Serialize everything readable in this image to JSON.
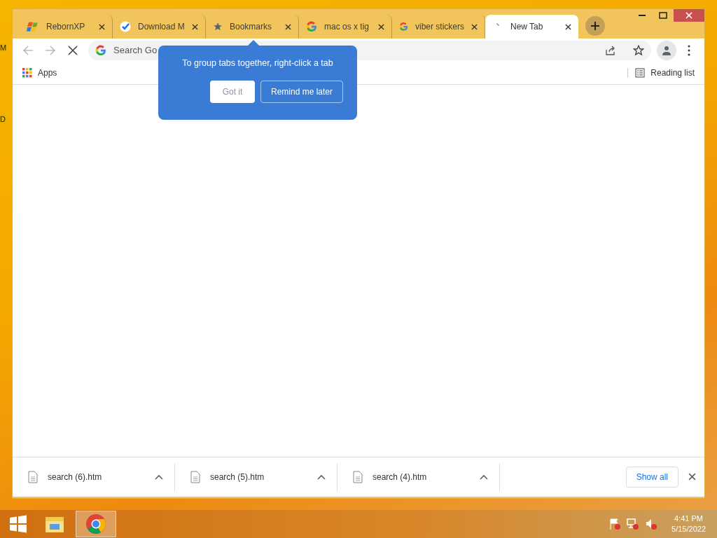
{
  "desktop_labels": [
    "M",
    "D"
  ],
  "tabs": [
    {
      "title": "RebornXP",
      "selected": false
    },
    {
      "title": "Download M",
      "selected": false
    },
    {
      "title": "Bookmarks",
      "selected": false
    },
    {
      "title": "mac os x tig",
      "selected": false
    },
    {
      "title": "viber stickers",
      "selected": false
    },
    {
      "title": "New Tab",
      "selected": true
    }
  ],
  "omnibox": {
    "placeholder": "Search Go"
  },
  "bookmarks_bar": {
    "apps": "Apps",
    "reading_list": "Reading list"
  },
  "bubble": {
    "message": "To group tabs together, right-click a tab",
    "buttons": [
      "Got it",
      "Remind me later"
    ]
  },
  "downloads": [
    {
      "name": "search (6).htm"
    },
    {
      "name": "search (5).htm"
    },
    {
      "name": "search (4).htm"
    }
  ],
  "show_all": "Show all",
  "clock": {
    "time": "4:41 PM",
    "date": "5/15/2022"
  }
}
